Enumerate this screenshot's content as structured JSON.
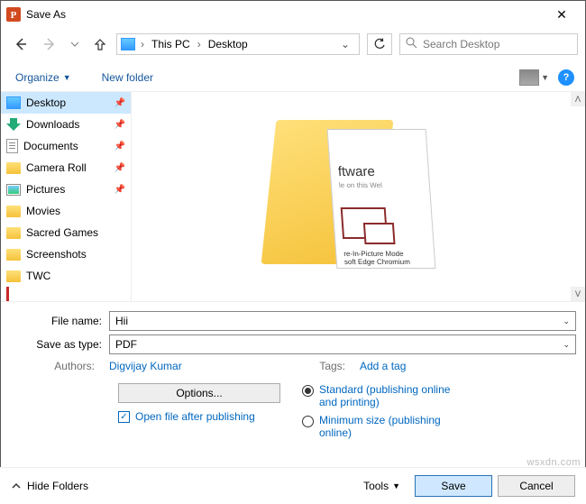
{
  "window": {
    "title": "Save As"
  },
  "breadcrumb": {
    "root": "This PC",
    "sep": "›",
    "leaf": "Desktop"
  },
  "search": {
    "placeholder": "Search Desktop"
  },
  "toolbar": {
    "organize": "Organize",
    "newfolder": "New folder"
  },
  "sidebar": {
    "items": [
      {
        "label": "Desktop",
        "icon": "desktop",
        "pinned": true,
        "selected": true
      },
      {
        "label": "Downloads",
        "icon": "download",
        "pinned": true
      },
      {
        "label": "Documents",
        "icon": "doc",
        "pinned": true
      },
      {
        "label": "Camera Roll",
        "icon": "folder",
        "pinned": true
      },
      {
        "label": "Pictures",
        "icon": "pic",
        "pinned": true
      },
      {
        "label": "Movies",
        "icon": "folder"
      },
      {
        "label": "Sacred Games",
        "icon": "folder"
      },
      {
        "label": "Screenshots",
        "icon": "folder"
      },
      {
        "label": "TWC",
        "icon": "folder"
      }
    ]
  },
  "preview": {
    "t1": "ftware",
    "t2": "le on this Wel",
    "t3": "re-In-Picture Mode",
    "t4": "soft Edge Chromium"
  },
  "form": {
    "filename_label": "File name:",
    "filename_value": "Hii",
    "filetype_label": "Save as type:",
    "filetype_value": "PDF",
    "authors_label": "Authors:",
    "authors_value": "Digvijay Kumar",
    "tags_label": "Tags:",
    "tags_value": "Add a tag"
  },
  "options": {
    "button": "Options...",
    "checkbox": "Open file after publishing",
    "radio_standard": "Standard (publishing online and printing)",
    "radio_minimum": "Minimum size (publishing online)"
  },
  "footer": {
    "hide": "Hide Folders",
    "tools": "Tools",
    "save": "Save",
    "cancel": "Cancel"
  },
  "watermark": "wsxdn.com"
}
